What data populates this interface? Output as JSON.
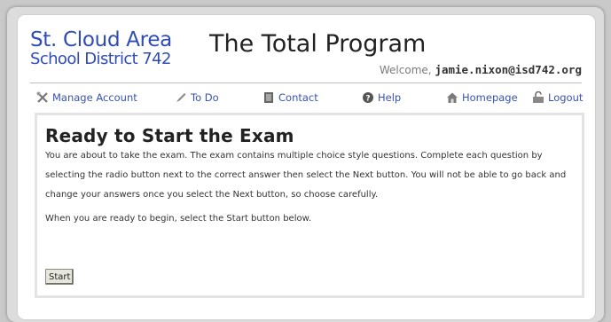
{
  "header": {
    "logo_line1": "St. Cloud Area",
    "logo_line2": "School District 742",
    "title": "The Total Program",
    "welcome_prefix": "Welcome,",
    "user_email": "jamie.nixon@isd742.org"
  },
  "nav": {
    "manage_account": "Manage Account",
    "todo": "To Do",
    "contact": "Contact",
    "help": "Help",
    "homepage": "Homepage",
    "logout": "Logout"
  },
  "exam": {
    "heading": "Ready to Start the Exam",
    "instructions": "You are about to take the exam.  The exam contains multiple choice style questions.  Complete each question by selecting the radio button next to the correct answer then select the Next button.  You will not be able to go back and change your answers once you select the Next button, so choose carefully.",
    "ready_text": "When you are ready to begin, select the Start button below.",
    "start_label": "Start"
  },
  "colors": {
    "link": "#3953b4",
    "logo": "#2f4bb8"
  }
}
